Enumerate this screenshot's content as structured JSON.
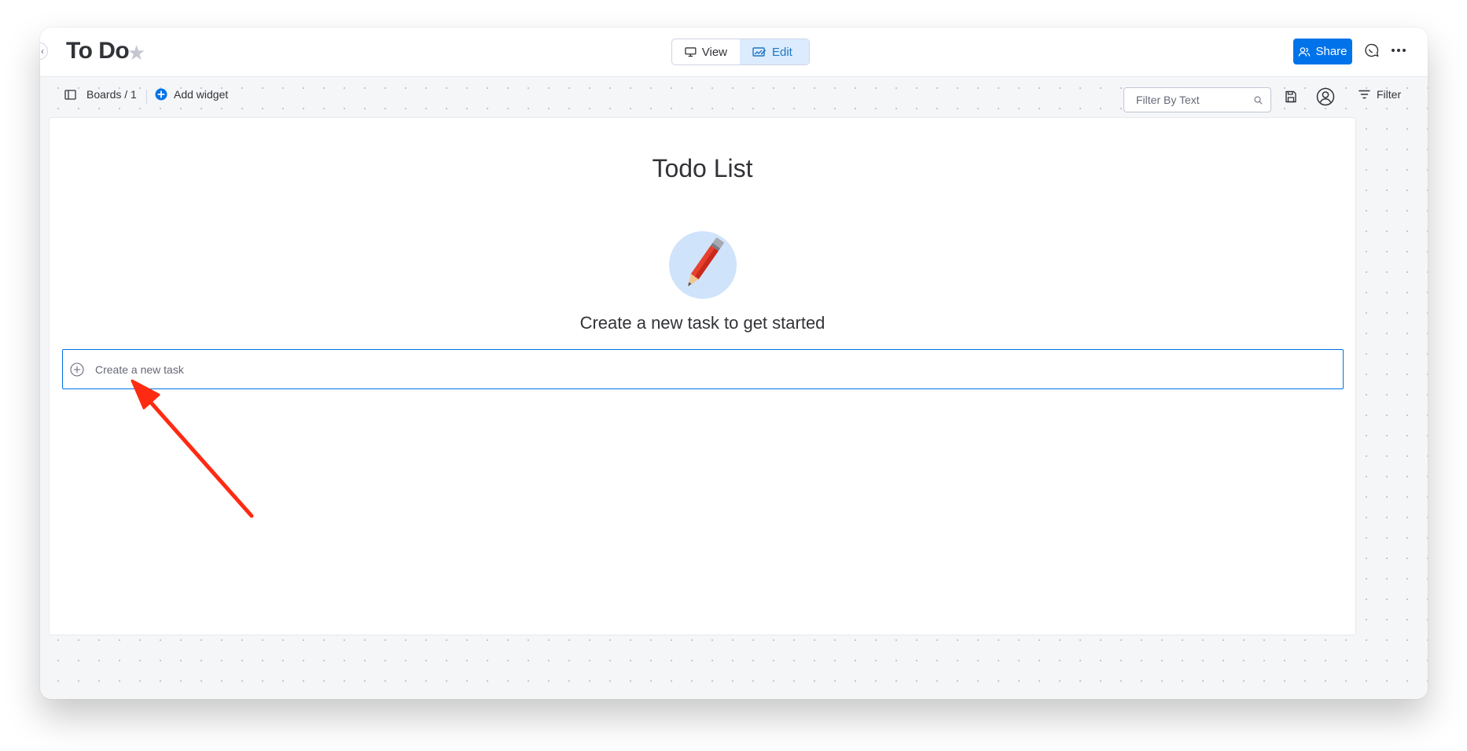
{
  "header": {
    "title": "To Do",
    "view_label": "View",
    "edit_label": "Edit",
    "share_label": "Share"
  },
  "toolbar": {
    "boards_label": "Boards / 1",
    "add_widget_label": "Add widget",
    "filter_placeholder": "Filter By Text",
    "filter_label": "Filter"
  },
  "widget": {
    "title": "Todo List",
    "empty_message": "Create a new task to get started",
    "new_task_placeholder": "Create a new task"
  },
  "colors": {
    "accent": "#0073ea",
    "edit_active_bg": "#dcebfe",
    "annotation_arrow": "#ff2a12"
  },
  "icons": [
    "chevron-left-icon",
    "star-icon",
    "monitor-icon",
    "chart-edit-icon",
    "users-icon",
    "chat-icon",
    "more-icon",
    "sidebar-icon",
    "plus-circle-icon",
    "search-icon",
    "save-icon",
    "person-icon",
    "filter-icon",
    "pencil-icon",
    "plus-icon",
    "arrow-icon"
  ]
}
